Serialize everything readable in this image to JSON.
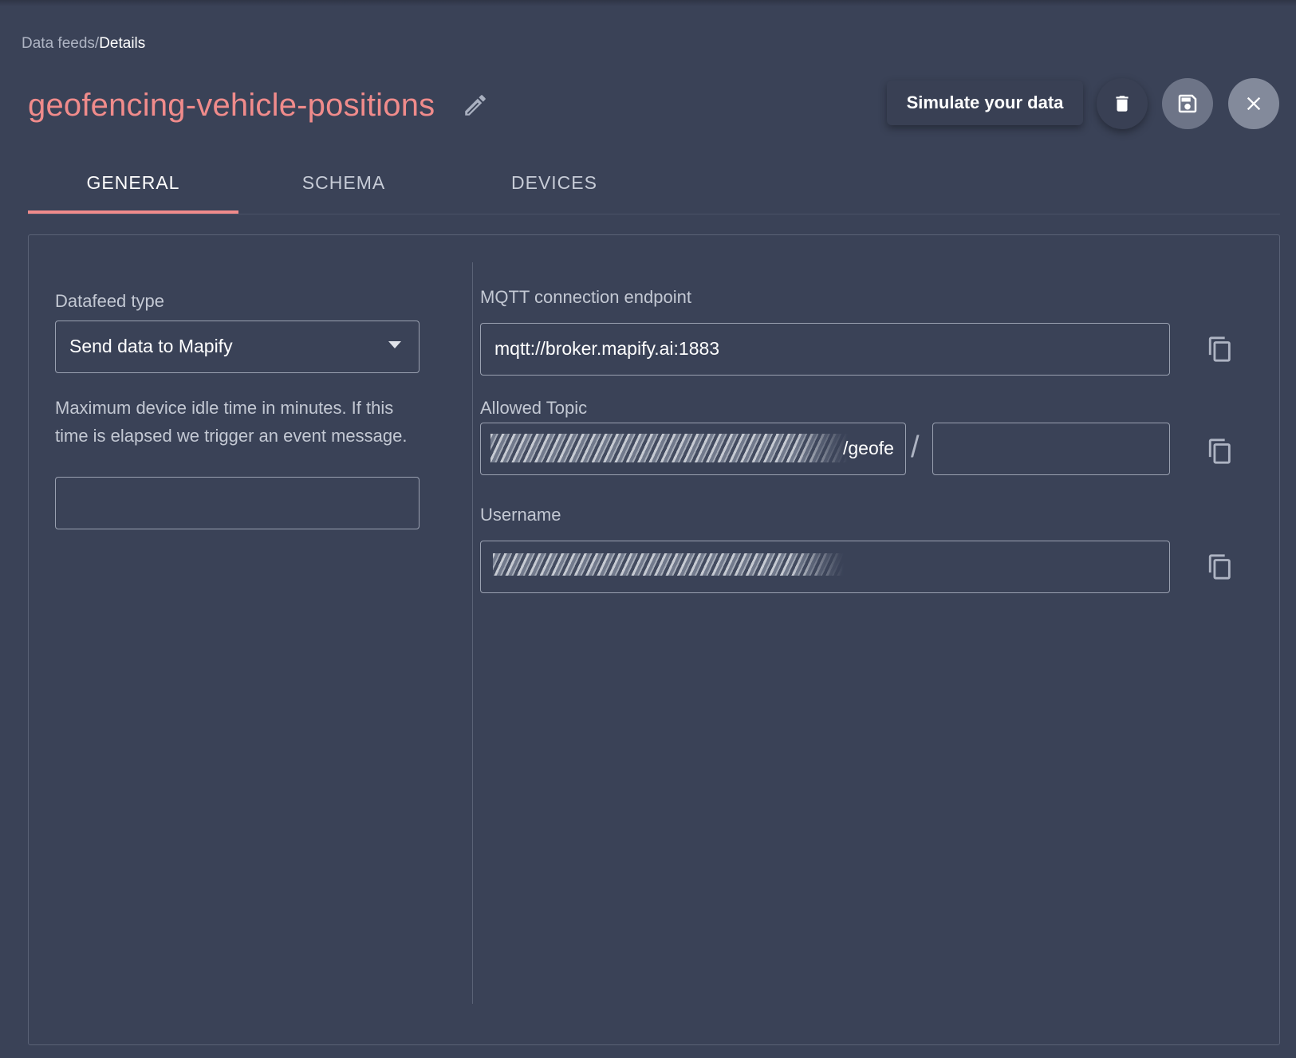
{
  "breadcrumb": {
    "parent": "Data feeds",
    "separator": "/",
    "current": "Details"
  },
  "page": {
    "title": "geofencing-vehicle-positions"
  },
  "actions": {
    "simulate_label": "Simulate your data",
    "delete_icon": "trash-icon",
    "save_icon": "save-icon",
    "close_icon": "close-icon"
  },
  "tabs": [
    {
      "label": "GENERAL",
      "active": true
    },
    {
      "label": "SCHEMA",
      "active": false
    },
    {
      "label": "DEVICES",
      "active": false
    }
  ],
  "general": {
    "datafeed_type_label": "Datafeed type",
    "datafeed_type_value": "Send data to Mapify",
    "idle_time_help": "Maximum device idle time in minutes. If this time is elapsed we trigger an event message.",
    "idle_time_value": "",
    "mqtt_endpoint_label": "MQTT connection endpoint",
    "mqtt_endpoint_value": "mqtt://broker.mapify.ai:1883",
    "allowed_topic_label": "Allowed Topic",
    "allowed_topic_visible_suffix": "/geofe",
    "allowed_topic_separator": "/",
    "allowed_topic_extra_value": "",
    "username_label": "Username"
  },
  "colors": {
    "background": "#3a4257",
    "accent": "#f08b8b",
    "text_muted": "#c3c8d3"
  }
}
